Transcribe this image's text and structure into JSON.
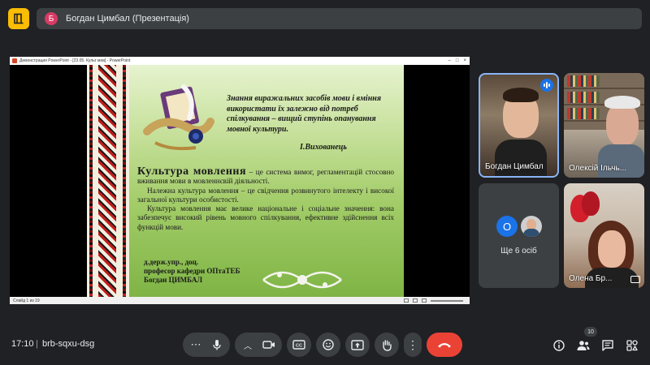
{
  "header": {
    "presenter_initial": "Б",
    "title": "Богдан Цимбал (Презентація)"
  },
  "presentation_window": {
    "title": "Демонстрация PowerPoint - [23.05. Культ мов] - PowerPoint",
    "status": "Слайд 1 из 19"
  },
  "slide": {
    "quote": "Знання виражальних засобів мови і вміння використати їх залежно від потреб спілкування – вищий ступінь опанування мовної культури.",
    "quote_author": "І.Вихованець",
    "heading": "Культура мовлення",
    "paragraph_1_rest": " – це система вимог, регламентацій стосовно вживання мови в мовленнєвій діяльності.",
    "paragraph_2": "Належна культура мовлення – це свідчення розвинутого інтелекту і високої загальної культури особистості.",
    "paragraph_3": "Культура мовлення має велике національне і соціальне значення: вона забезпечує високий рівень мовного спілкування, ефективне здійснення всіх функцій мови.",
    "signature_line_1": "д.держ.упр., доц.",
    "signature_line_2": "професор кафедри ОПтаТЕБ",
    "signature_line_3": "Богдан ЦИМБАЛ"
  },
  "participants": [
    {
      "name": "Богдан Цимбал",
      "speaking": true
    },
    {
      "name": "Олексій Ільчь..."
    },
    {
      "name": "Ще 6 осіб",
      "avatar_initial": "О"
    },
    {
      "name": "Олена Бр..."
    }
  ],
  "footer": {
    "time": "17:10",
    "meeting_code": "brb-sqxu-dsg",
    "people_count": "10"
  },
  "colors": {
    "end_call": "#ea4335",
    "accent_blue": "#1a73e8",
    "app_icon": "#fbbc04"
  }
}
